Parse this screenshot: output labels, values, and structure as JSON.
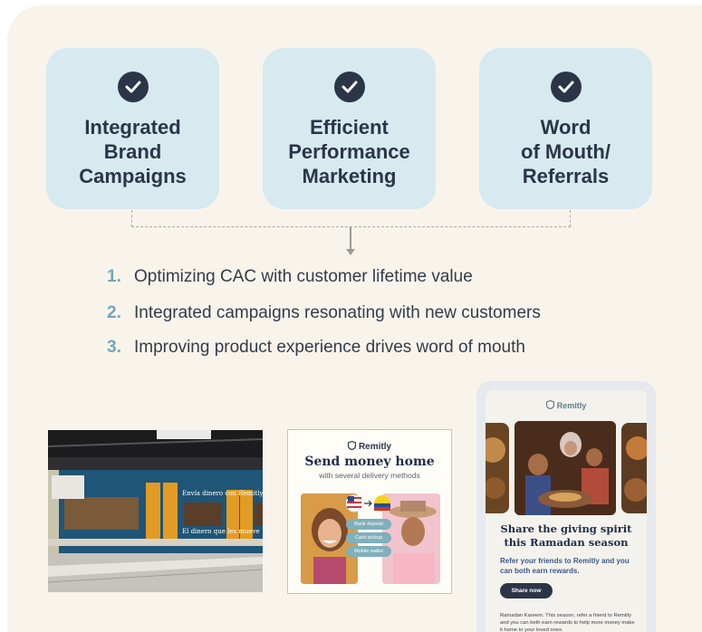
{
  "pillars": [
    {
      "title": "Integrated\nBrand\nCampaigns"
    },
    {
      "title": "Efficient\nPerformance\nMarketing"
    },
    {
      "title": "Word\nof Mouth/\nReferrals"
    }
  ],
  "points": [
    {
      "num": "1.",
      "text": "Optimizing CAC with customer lifetime value"
    },
    {
      "num": "2.",
      "text": "Integrated campaigns resonating with new customers"
    },
    {
      "num": "3.",
      "text": "Improving product experience drives word of mouth"
    }
  ],
  "subway_ad": {
    "headline": "Envía dinero con Remitly",
    "tagline": "El dinero que les mueve"
  },
  "ad_card": {
    "logo": "Remitly",
    "headline": "Send money home",
    "subtitle": "with several delivery methods",
    "options": [
      "Bank deposit",
      "Cash pickup",
      "Mobile wallet"
    ]
  },
  "phone": {
    "logo": "Remitly",
    "headline": "Share the giving spirit\nthis Ramadan season",
    "subtext": "Refer your friends to Remitly and you can both earn rewards.",
    "button": "Share now",
    "body": "Ramadan Kareem. This season, refer a friend to Remitly and you can both earn rewards to help more money make it home to your loved ones."
  },
  "colors": {
    "panel_bg": "#f8f4ec",
    "pillar_bg": "#d6eaef",
    "navy": "#2c3548",
    "accent_teal": "#6fa8b6"
  },
  "icons": [
    "check-circle-icon",
    "arrow-down-icon",
    "remitly-shield-icon"
  ]
}
